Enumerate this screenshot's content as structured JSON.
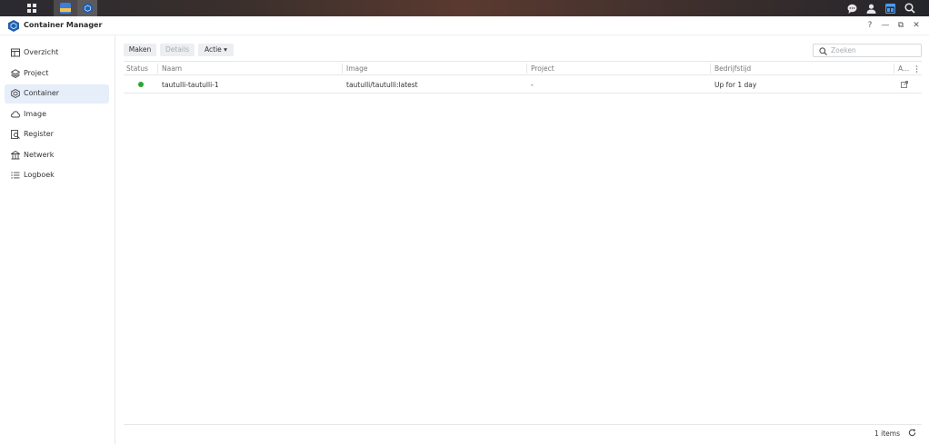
{
  "taskbar": {
    "left_icons": [
      "grid-icon",
      "app-icon",
      "container-manager-icon"
    ],
    "right_icons": [
      "chat-icon",
      "user-icon",
      "widgets-icon",
      "search-icon"
    ]
  },
  "window": {
    "title": "Container Manager",
    "controls": {
      "help": "?",
      "minimize": "—",
      "restore": "⧉",
      "close": "✕"
    }
  },
  "sidebar": {
    "items": [
      {
        "label": "Overzicht",
        "icon": "overview-icon"
      },
      {
        "label": "Project",
        "icon": "layers-icon"
      },
      {
        "label": "Container",
        "icon": "hexagon-icon",
        "active": true
      },
      {
        "label": "Image",
        "icon": "cloud-icon"
      },
      {
        "label": "Register",
        "icon": "registry-search-icon"
      },
      {
        "label": "Netwerk",
        "icon": "network-icon"
      },
      {
        "label": "Logboek",
        "icon": "list-icon"
      }
    ]
  },
  "toolbar": {
    "create_label": "Maken",
    "details_label": "Details",
    "action_label": "Actie ▾",
    "search_placeholder": "Zoeken"
  },
  "table": {
    "columns": [
      "Status",
      "Naam",
      "Image",
      "Project",
      "Bedrijfstijd",
      "A..."
    ],
    "rows": [
      {
        "status": "running",
        "name": "tautulli-tautulli-1",
        "image": "tautulli/tautulli:latest",
        "project": "-",
        "uptime": "Up for 1 day"
      }
    ]
  },
  "footer": {
    "count": "1 items"
  },
  "colors": {
    "accent": "#2b6ad8",
    "status_running": "#2ea62e",
    "active_bg": "#e6eefa"
  }
}
